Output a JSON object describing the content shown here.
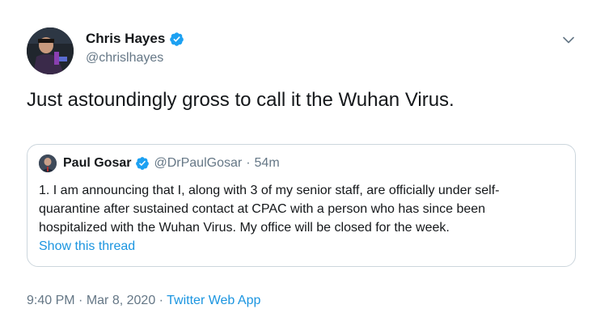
{
  "author": {
    "display_name": "Chris Hayes",
    "handle": "@chrislhayes",
    "verified": true
  },
  "tweet": {
    "text": "Just astoundingly gross to call it the Wuhan Virus."
  },
  "quoted_tweet": {
    "display_name": "Paul Gosar",
    "verified": true,
    "handle": "@DrPaulGosar",
    "separator": "·",
    "time": "54m",
    "lines": [
      "1. I am announcing that I, along with 3 of my senior staff, are officially under self-",
      "quarantine after sustained contact at CPAC with a person who has since been",
      "hospitalized with the Wuhan Virus.  My office will be closed for the week."
    ],
    "show_thread": "Show this thread"
  },
  "meta": {
    "time": "9:40 PM",
    "sep1": "·",
    "date": "Mar 8, 2020",
    "sep2": "·",
    "source": "Twitter Web App"
  },
  "icons": {
    "verified": "verified-badge-icon",
    "more": "chevron-down-icon"
  },
  "colors": {
    "text": "#14171a",
    "secondary": "#657786",
    "link": "#1b95e0",
    "verified": "#1da1f2",
    "border": "#ccd6dd"
  }
}
